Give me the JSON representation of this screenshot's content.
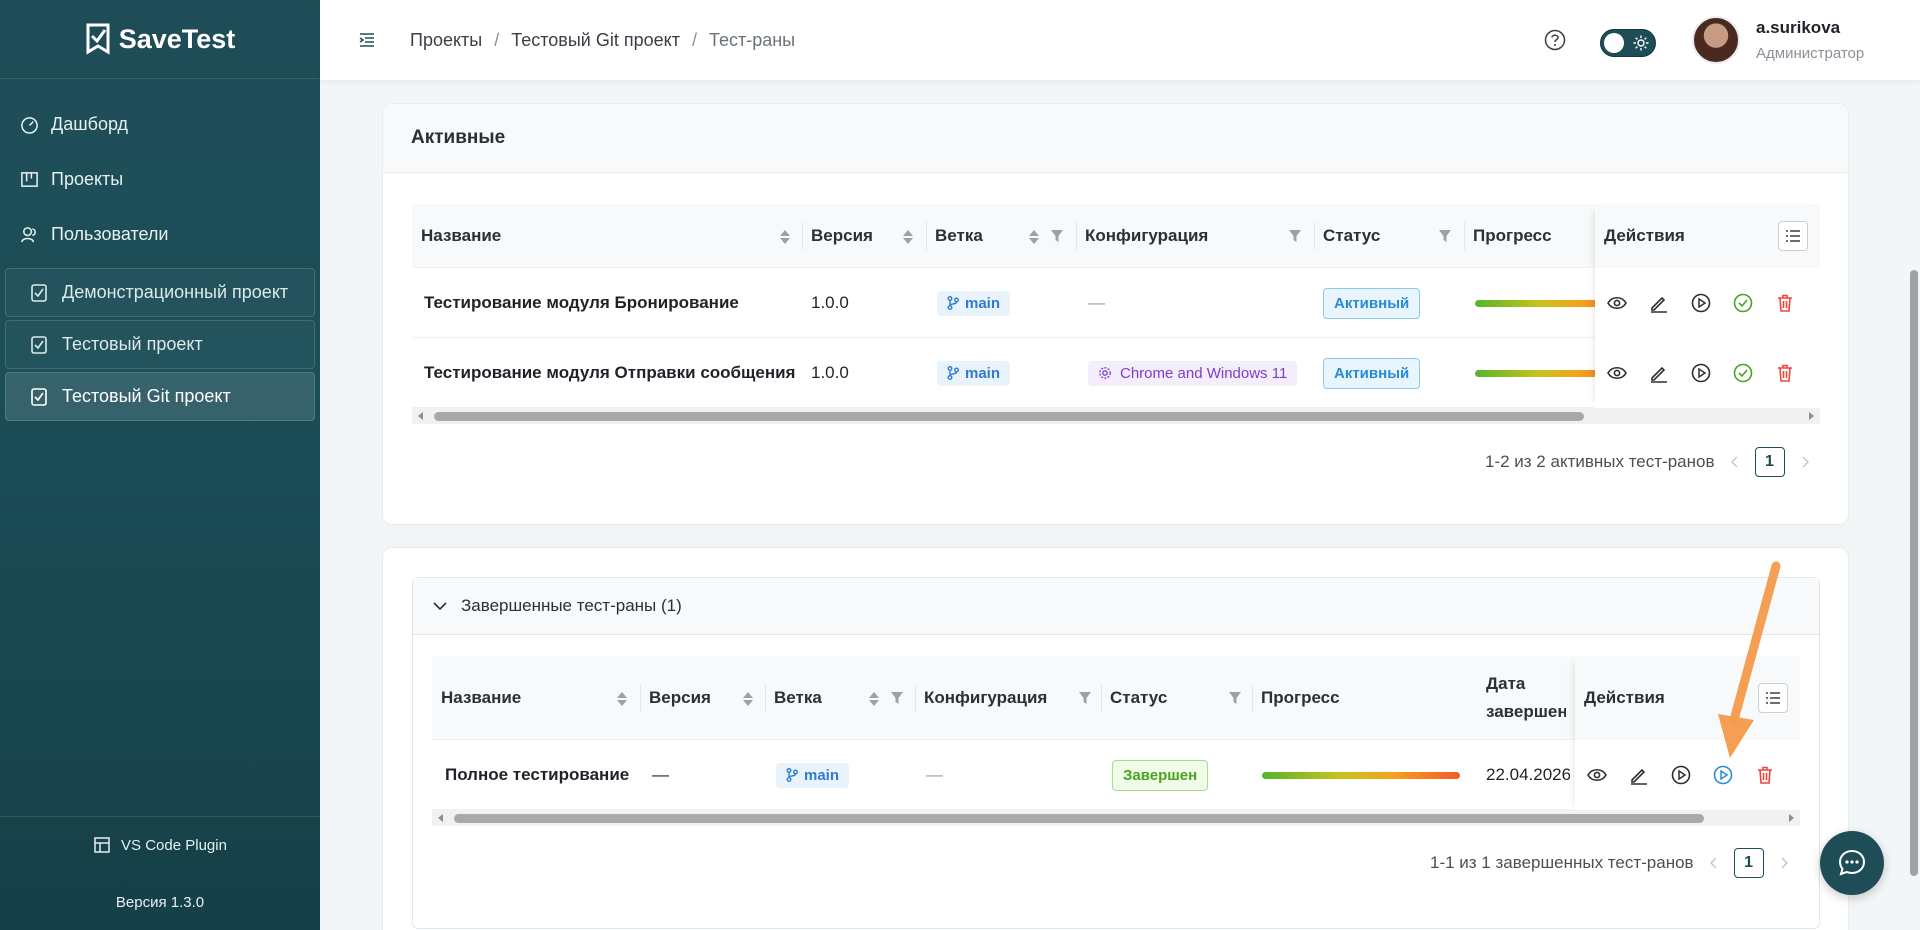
{
  "app": {
    "brand": "SaveTest"
  },
  "sidebar": {
    "nav": [
      {
        "label": "Дашборд",
        "icon": "dashboard-icon"
      },
      {
        "label": "Проекты",
        "icon": "projects-icon"
      },
      {
        "label": "Пользователи",
        "icon": "users-icon"
      }
    ],
    "projects": [
      {
        "label": "Демонстрационный проект",
        "active": false
      },
      {
        "label": "Тестовый проект",
        "active": false
      },
      {
        "label": "Тестовый Git проект",
        "active": true
      }
    ],
    "plugin": "VS Code Plugin",
    "version": "Версия 1.3.0"
  },
  "header": {
    "breadcrumb": [
      "Проекты",
      "Тестовый Git проект",
      "Тест-раны"
    ],
    "separator": "/",
    "user_name": "a.surikova",
    "user_role": "Администратор"
  },
  "active_section": {
    "title": "Активные",
    "columns": [
      "Название",
      "Версия",
      "Ветка",
      "Конфигурация",
      "Статус",
      "Прогресс",
      "Действия"
    ],
    "rows": [
      {
        "name": "Тестирование модуля Бронирование",
        "version": "1.0.0",
        "branch": "main",
        "config": "—",
        "status": "Активный"
      },
      {
        "name": "Тестирование модуля Отправки сообщения",
        "version": "1.0.0",
        "branch": "main",
        "config": "Chrome and Windows 11",
        "status": "Активный"
      }
    ],
    "pager_text": "1-2 из 2 активных тест-ранов",
    "page": "1"
  },
  "completed_section": {
    "title": "Завершенные тест-раны (1)",
    "columns": [
      "Название",
      "Версия",
      "Ветка",
      "Конфигурация",
      "Статус",
      "Прогресс",
      "Дата",
      "завершени",
      "Действия"
    ],
    "rows": [
      {
        "name": "Полное тестирование",
        "version": "—",
        "branch": "main",
        "config": "—",
        "status": "Завершен",
        "date": "22.04.2026"
      }
    ],
    "pager_text": "1-1 из 1 завершенных тест-ранов",
    "page": "1"
  },
  "colors": {
    "brand": "#1f4d57",
    "active_status": "#2a8bd4",
    "done_status": "#47a51f",
    "delete": "#f0453a",
    "annotation_arrow": "#f39a4b"
  }
}
